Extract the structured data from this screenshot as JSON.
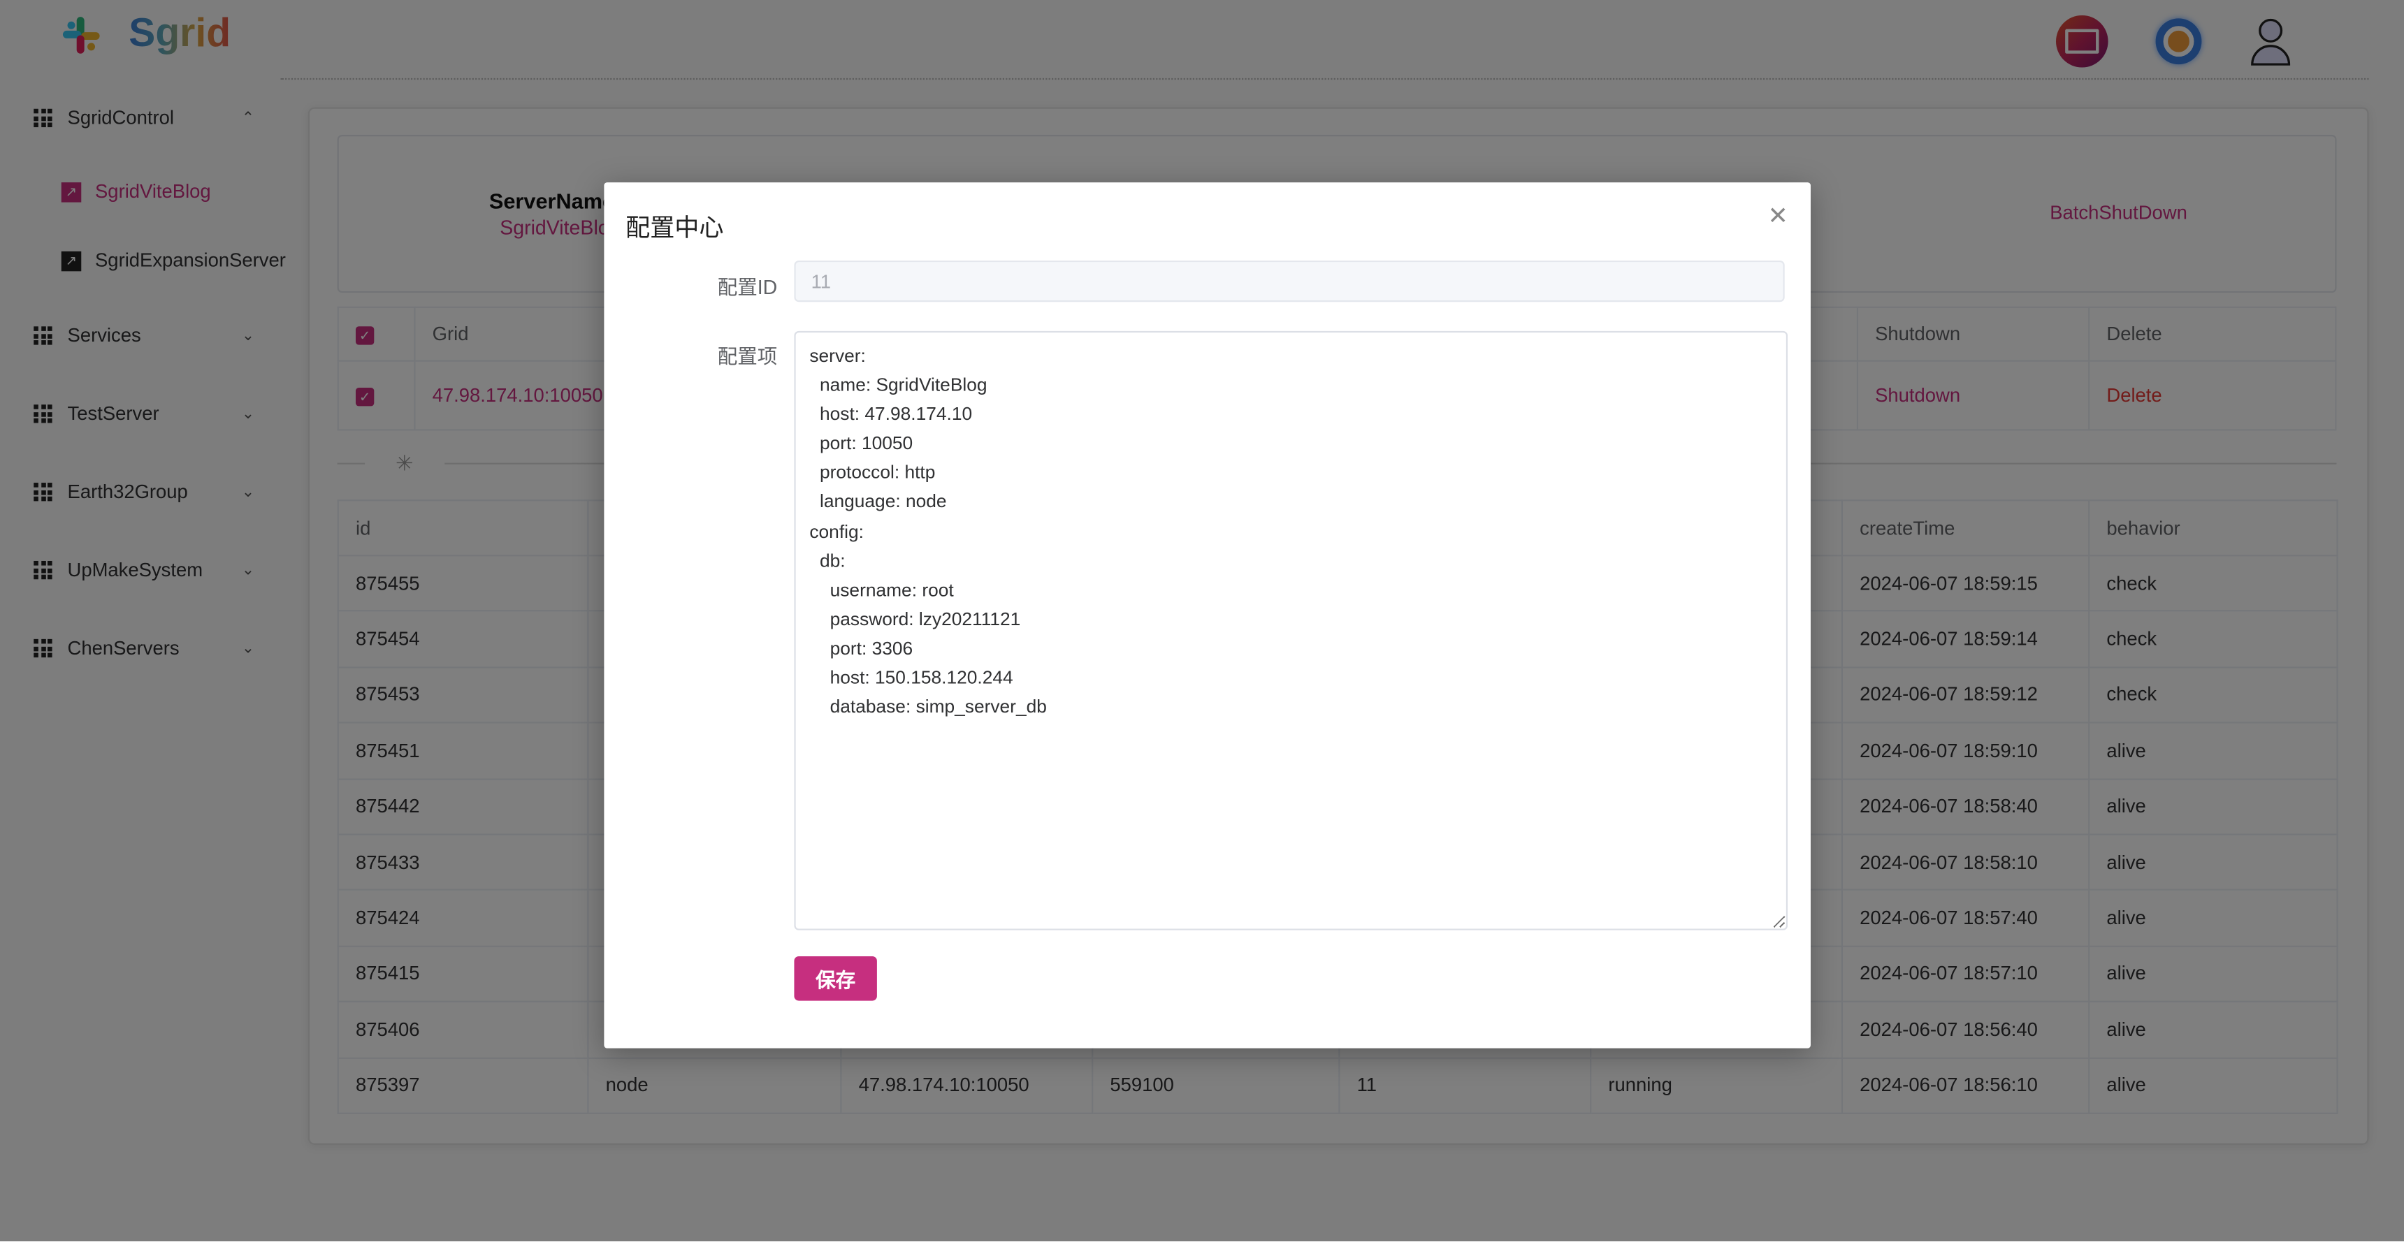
{
  "app": {
    "logo_text": "Sgrid"
  },
  "header": {
    "icons": [
      "monitor-dashboard-icon",
      "gear-icon",
      "user-icon"
    ]
  },
  "sidebar": {
    "groups": [
      {
        "label": "SgridControl",
        "expanded": true,
        "children": [
          {
            "label": "SgridViteBlog",
            "active": true
          },
          {
            "label": "SgridExpansionServer",
            "active": false
          }
        ]
      },
      {
        "label": "Services",
        "expanded": false
      },
      {
        "label": "TestServer",
        "expanded": false
      },
      {
        "label": "Earth32Group",
        "expanded": false
      },
      {
        "label": "UpMakeSystem",
        "expanded": false
      },
      {
        "label": "ChenServers",
        "expanded": false
      }
    ]
  },
  "panel": {
    "server_name_label": "ServerName",
    "server_name_value": "SgridViteBlog",
    "batch_shutdown": "BatchShutDown"
  },
  "grid_table": {
    "headers": {
      "grid": "Grid",
      "shutdown": "Shutdown",
      "delete": "Delete"
    },
    "rows": [
      {
        "grid": "47.98.174.10:10050",
        "shutdown": "Shutdown",
        "delete": "Delete",
        "checked": true
      }
    ]
  },
  "log_table": {
    "headers": {
      "id": "id",
      "createTime": "createTime",
      "behavior": "behavior"
    },
    "rows": [
      {
        "id": "875455",
        "createTime": "2024-06-07 18:59:15",
        "behavior": "check"
      },
      {
        "id": "875454",
        "createTime": "2024-06-07 18:59:14",
        "behavior": "check"
      },
      {
        "id": "875453",
        "createTime": "2024-06-07 18:59:12",
        "behavior": "check"
      },
      {
        "id": "875451",
        "createTime": "2024-06-07 18:59:10",
        "behavior": "alive"
      },
      {
        "id": "875442",
        "createTime": "2024-06-07 18:58:40",
        "behavior": "alive"
      },
      {
        "id": "875433",
        "createTime": "2024-06-07 18:58:10",
        "behavior": "alive"
      },
      {
        "id": "875424",
        "createTime": "2024-06-07 18:57:40",
        "behavior": "alive"
      },
      {
        "id": "875415",
        "createTime": "2024-06-07 18:57:10",
        "behavior": "alive"
      },
      {
        "id": "875406",
        "createTime": "2024-06-07 18:56:40",
        "behavior": "alive"
      },
      {
        "id": "875397",
        "c2": "node",
        "c3": "47.98.174.10:10050",
        "c4": "559100",
        "c5": "11",
        "c6": "running",
        "createTime": "2024-06-07 18:56:10",
        "behavior": "alive"
      }
    ]
  },
  "modal": {
    "title": "配置中心",
    "config_id_label": "配置ID",
    "config_id_value": "11",
    "config_items_label": "配置项",
    "config_items_value": "server:\n  name: SgridViteBlog\n  host: 47.98.174.10\n  port: 10050\n  protoccol: http\n  language: node\nconfig:\n  db:\n    username: root\n    password: lzy20211121\n    port: 3306\n    host: 150.158.120.244\n    database: simp_server_db",
    "save_label": "保存"
  },
  "colors": {
    "accent": "#c62f7f",
    "danger": "#e53935",
    "overlay": "rgba(0,0,0,0.5)"
  }
}
